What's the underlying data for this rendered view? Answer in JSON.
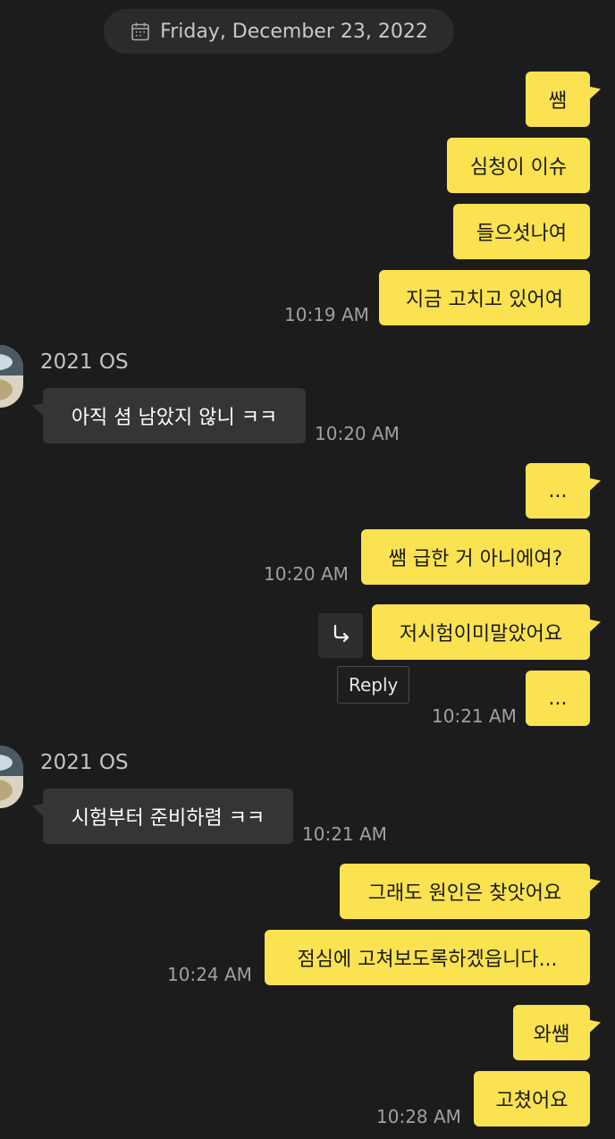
{
  "date_header": {
    "label": "Friday, December 23, 2022",
    "icon": "calendar-icon"
  },
  "sender_name": "2021 OS",
  "messages": [
    {
      "text": "쌤"
    },
    {
      "text": "심청이 이슈"
    },
    {
      "text": "들으셧나여"
    },
    {
      "text": "지금 고치고 있어여",
      "time": "10:19 AM"
    },
    {
      "text": "아직 셤 남았지 않니 ㅋㅋ",
      "time": "10:20 AM"
    },
    {
      "text": "..."
    },
    {
      "text": "쌤 급한 거 아니에여?",
      "time": "10:20 AM"
    },
    {
      "text": "저시험이미말았어요"
    },
    {
      "text": "...",
      "time": "10:21 AM"
    },
    {
      "text": "시험부터 준비하렴 ㅋㅋ",
      "time": "10:21 AM"
    },
    {
      "text": "그래도 원인은 찾앗어요"
    },
    {
      "text": "점심에 고쳐보도록하겠읍니다...",
      "time": "10:24 AM"
    },
    {
      "text": "와쌤"
    },
    {
      "text": "고쳤어요",
      "time": "10:28 AM"
    }
  ],
  "reply_tooltip": "Reply",
  "colors": {
    "my_bubble": "#fbe250",
    "their_bubble": "#353535",
    "background": "#1c1c1c"
  }
}
